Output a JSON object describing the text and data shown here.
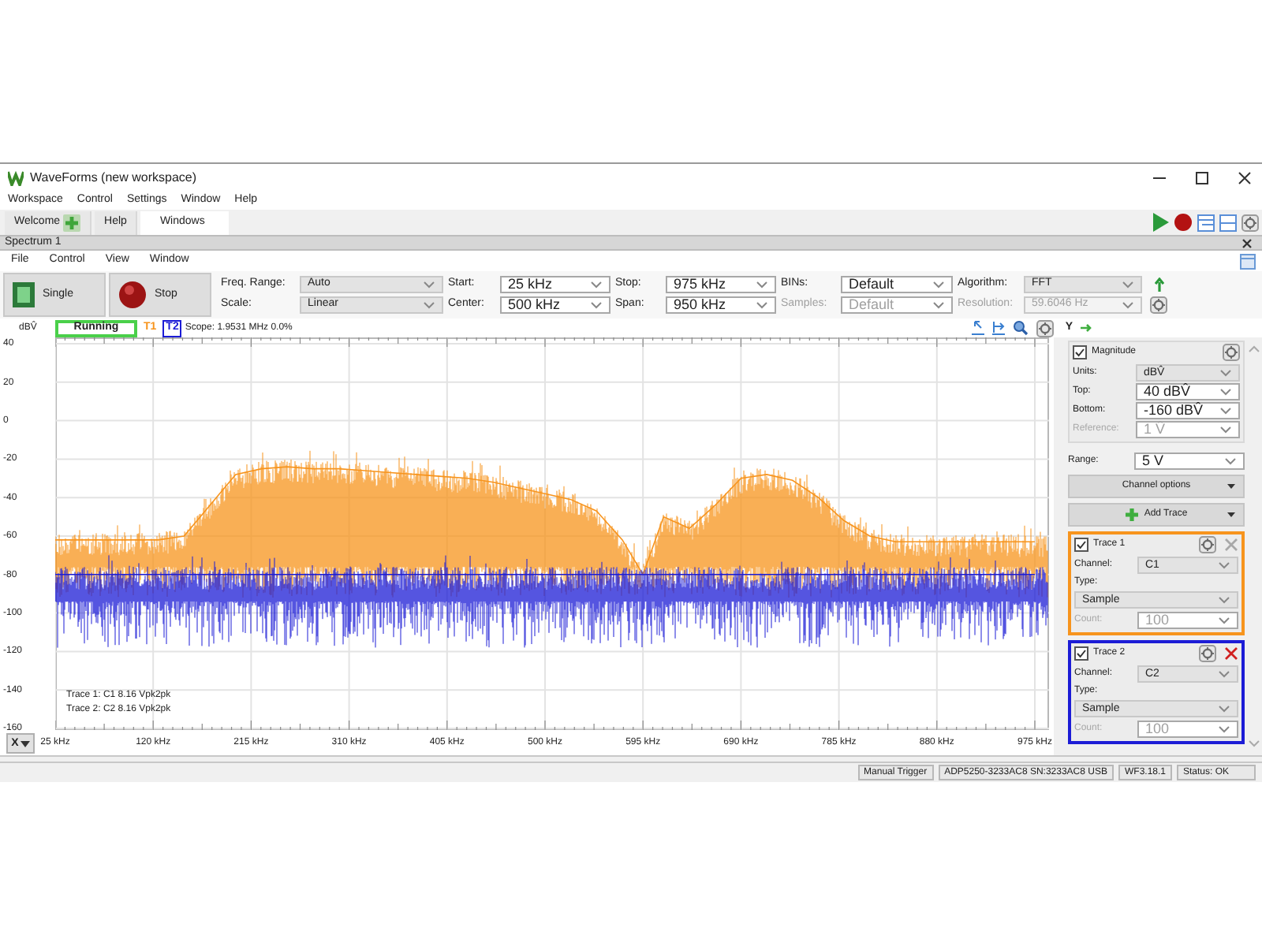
{
  "window": {
    "title": "WaveForms (new workspace)"
  },
  "menu": [
    "Workspace",
    "Control",
    "Settings",
    "Window",
    "Help"
  ],
  "tabs": [
    {
      "label": "Welcome",
      "selected": false,
      "add_icon": true
    },
    {
      "label": "Help",
      "selected": false,
      "add_icon": false
    },
    {
      "label": "Windows",
      "selected": true,
      "add_icon": false
    }
  ],
  "instrument": {
    "title": "Spectrum 1",
    "menu": [
      "File",
      "Control",
      "View",
      "Window"
    ],
    "run_buttons": [
      {
        "label": "Single",
        "kind": "single"
      },
      {
        "label": "Stop",
        "kind": "stop"
      }
    ],
    "field_rows": [
      [
        {
          "label": "Freq. Range:",
          "value": "Auto",
          "kind": "select",
          "disabled": false
        },
        {
          "label": "Start:",
          "value": "25 kHz",
          "kind": "edit",
          "disabled": false
        },
        {
          "label": "Stop:",
          "value": "975 kHz",
          "kind": "edit",
          "disabled": false
        },
        {
          "label": "BINs:",
          "value": "Default",
          "kind": "edit",
          "disabled": false
        },
        {
          "label": "Algorithm:",
          "value": "FFT",
          "kind": "select",
          "disabled": false
        }
      ],
      [
        {
          "label": "Scale:",
          "value": "Linear",
          "kind": "select",
          "disabled": false
        },
        {
          "label": "Center:",
          "value": "500 kHz",
          "kind": "edit",
          "disabled": false
        },
        {
          "label": "Span:",
          "value": "950 kHz",
          "kind": "edit",
          "disabled": false
        },
        {
          "label": "Samples:",
          "value": "Default",
          "kind": "edit",
          "disabled": true
        },
        {
          "label": "Resolution:",
          "value": "59.6046 Hz",
          "kind": "select",
          "disabled": true
        }
      ]
    ]
  },
  "plot_header": {
    "unit": "dBV̂",
    "status": "Running",
    "trace_tags": [
      {
        "label": "T1",
        "selected": false
      },
      {
        "label": "T2",
        "selected": true
      }
    ],
    "scope": "Scope: 1.9531 MHz 0.0%",
    "y_button": "Y"
  },
  "plot": {
    "chart_data": {
      "type": "line",
      "grid": true,
      "xlim": [
        25,
        975
      ],
      "ylim": [
        -160,
        40
      ],
      "yticks": [
        40,
        20,
        0,
        -20,
        -40,
        -60,
        -80,
        -100,
        -120,
        -140,
        -160
      ],
      "xticks": [
        {
          "value": 25,
          "label": "25 kHz"
        },
        {
          "value": 120,
          "label": "120 kHz"
        },
        {
          "value": 215,
          "label": "215 kHz"
        },
        {
          "value": 310,
          "label": "310 kHz"
        },
        {
          "value": 405,
          "label": "405 kHz"
        },
        {
          "value": 500,
          "label": "500 kHz"
        },
        {
          "value": 595,
          "label": "595 kHz"
        },
        {
          "value": 690,
          "label": "690 kHz"
        },
        {
          "value": 785,
          "label": "785 kHz"
        },
        {
          "value": 880,
          "label": "880 kHz"
        },
        {
          "value": 975,
          "label": "975 kHz"
        }
      ],
      "x": [
        25,
        50,
        75,
        100,
        125,
        150,
        175,
        200,
        225,
        250,
        275,
        300,
        325,
        350,
        375,
        400,
        425,
        450,
        475,
        500,
        525,
        550,
        575,
        595,
        615,
        640,
        665,
        690,
        715,
        740,
        765,
        790,
        815,
        840,
        865,
        890,
        915,
        940,
        965,
        975
      ],
      "series": [
        {
          "color": "#f7941d",
          "values": [
            -62,
            -62,
            -62,
            -62,
            -62,
            -60,
            -44,
            -28,
            -25,
            -24,
            -25,
            -25,
            -26,
            -27,
            -28,
            -29,
            -30,
            -32,
            -35,
            -38,
            -41,
            -47,
            -62,
            -80,
            -50,
            -56,
            -44,
            -30,
            -28,
            -31,
            -40,
            -52,
            -60,
            -63,
            -63,
            -63,
            -63,
            -63,
            -63,
            -63
          ]
        },
        {
          "color": "#1c1cd6",
          "values": [
            -80,
            -80,
            -80,
            -80,
            -80,
            -80,
            -80,
            -80,
            -80,
            -80,
            -80,
            -80,
            -80,
            -80,
            -80,
            -80,
            -80,
            -80,
            -80,
            -80,
            -80,
            -80,
            -80,
            -80,
            -80,
            -80,
            -80,
            -80,
            -80,
            -80,
            -80,
            -80,
            -80,
            -80,
            -80,
            -80,
            -80,
            -80,
            -80,
            -80
          ]
        }
      ]
    },
    "legend": [
      "Trace 1: C1 8.16 Vpk2pk",
      "Trace 2: C2 8.16 Vpk2pk"
    ],
    "x_button": "X"
  },
  "panel": {
    "magnitude": {
      "label": "Magnitude",
      "checked": true,
      "rows": [
        {
          "label": "Units:",
          "value": "dBV̂",
          "kind": "select",
          "disabled": false
        },
        {
          "label": "Top:",
          "value": "40 dBV̂",
          "kind": "edit",
          "disabled": false
        },
        {
          "label": "Bottom:",
          "value": "-160 dBV̂",
          "kind": "edit",
          "disabled": false
        },
        {
          "label": "Reference:",
          "value": "1 V̂",
          "kind": "edit",
          "disabled": true
        }
      ]
    },
    "range": {
      "label": "Range:",
      "value": "5 V",
      "kind": "edit",
      "disabled": false
    },
    "buttons": [
      {
        "label": "Channel options",
        "kind": "menu"
      },
      {
        "label": "Add Trace",
        "kind": "add"
      }
    ],
    "traces": [
      {
        "label": "Trace 1",
        "checked": true,
        "color": "#f7941d",
        "removable": false,
        "channel": {
          "label": "Channel:",
          "value": "C1",
          "kind": "select",
          "disabled": false
        },
        "type": {
          "label": "Type:",
          "value": "Sample",
          "kind": "select",
          "disabled": false
        },
        "count": {
          "label": "Count:",
          "value": "100",
          "kind": "edit",
          "disabled": true
        }
      },
      {
        "label": "Trace 2",
        "checked": true,
        "color": "#1c1cd6",
        "removable": true,
        "channel": {
          "label": "Channel:",
          "value": "C2",
          "kind": "select",
          "disabled": false
        },
        "type": {
          "label": "Type:",
          "value": "Sample",
          "kind": "select",
          "disabled": false
        },
        "count": {
          "label": "Count:",
          "value": "100",
          "kind": "edit",
          "disabled": true
        }
      }
    ]
  },
  "status_bar": [
    "Manual Trigger",
    "ADP5250-3233AC8 SN:3233AC8 USB",
    "WF3.18.1",
    "Status: OK"
  ]
}
